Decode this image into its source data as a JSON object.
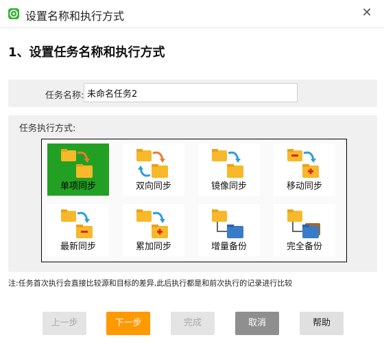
{
  "window": {
    "title": "设置名称和执行方式"
  },
  "heading": "1、设置任务名称和执行方式",
  "name_field": {
    "label": "任务名称:",
    "value": "未命名任务2"
  },
  "mode": {
    "label": "任务执行方式:",
    "options": [
      {
        "label": "单项同步",
        "icon": "one-way-sync-icon",
        "selected": true
      },
      {
        "label": "双向同步",
        "icon": "two-way-sync-icon",
        "selected": false
      },
      {
        "label": "镜像同步",
        "icon": "mirror-sync-icon",
        "selected": false
      },
      {
        "label": "移动同步",
        "icon": "move-sync-icon",
        "selected": false
      },
      {
        "label": "最新同步",
        "icon": "latest-sync-icon",
        "selected": false
      },
      {
        "label": "累加同步",
        "icon": "cumulative-sync-icon",
        "selected": false
      },
      {
        "label": "增量备份",
        "icon": "incremental-backup-icon",
        "selected": false
      },
      {
        "label": "完全备份",
        "icon": "full-backup-icon",
        "selected": false
      }
    ]
  },
  "note": "注:任务首次执行会直接比较源和目标的差异,此后执行都是和前次执行的记录进行比较",
  "buttons": {
    "prev": "上一步",
    "next": "下一步",
    "finish": "完成",
    "cancel": "取消",
    "help": "帮助"
  },
  "colors": {
    "selected": "#22a023",
    "primary_button": "#ff9900",
    "folder": "#f7b829"
  }
}
